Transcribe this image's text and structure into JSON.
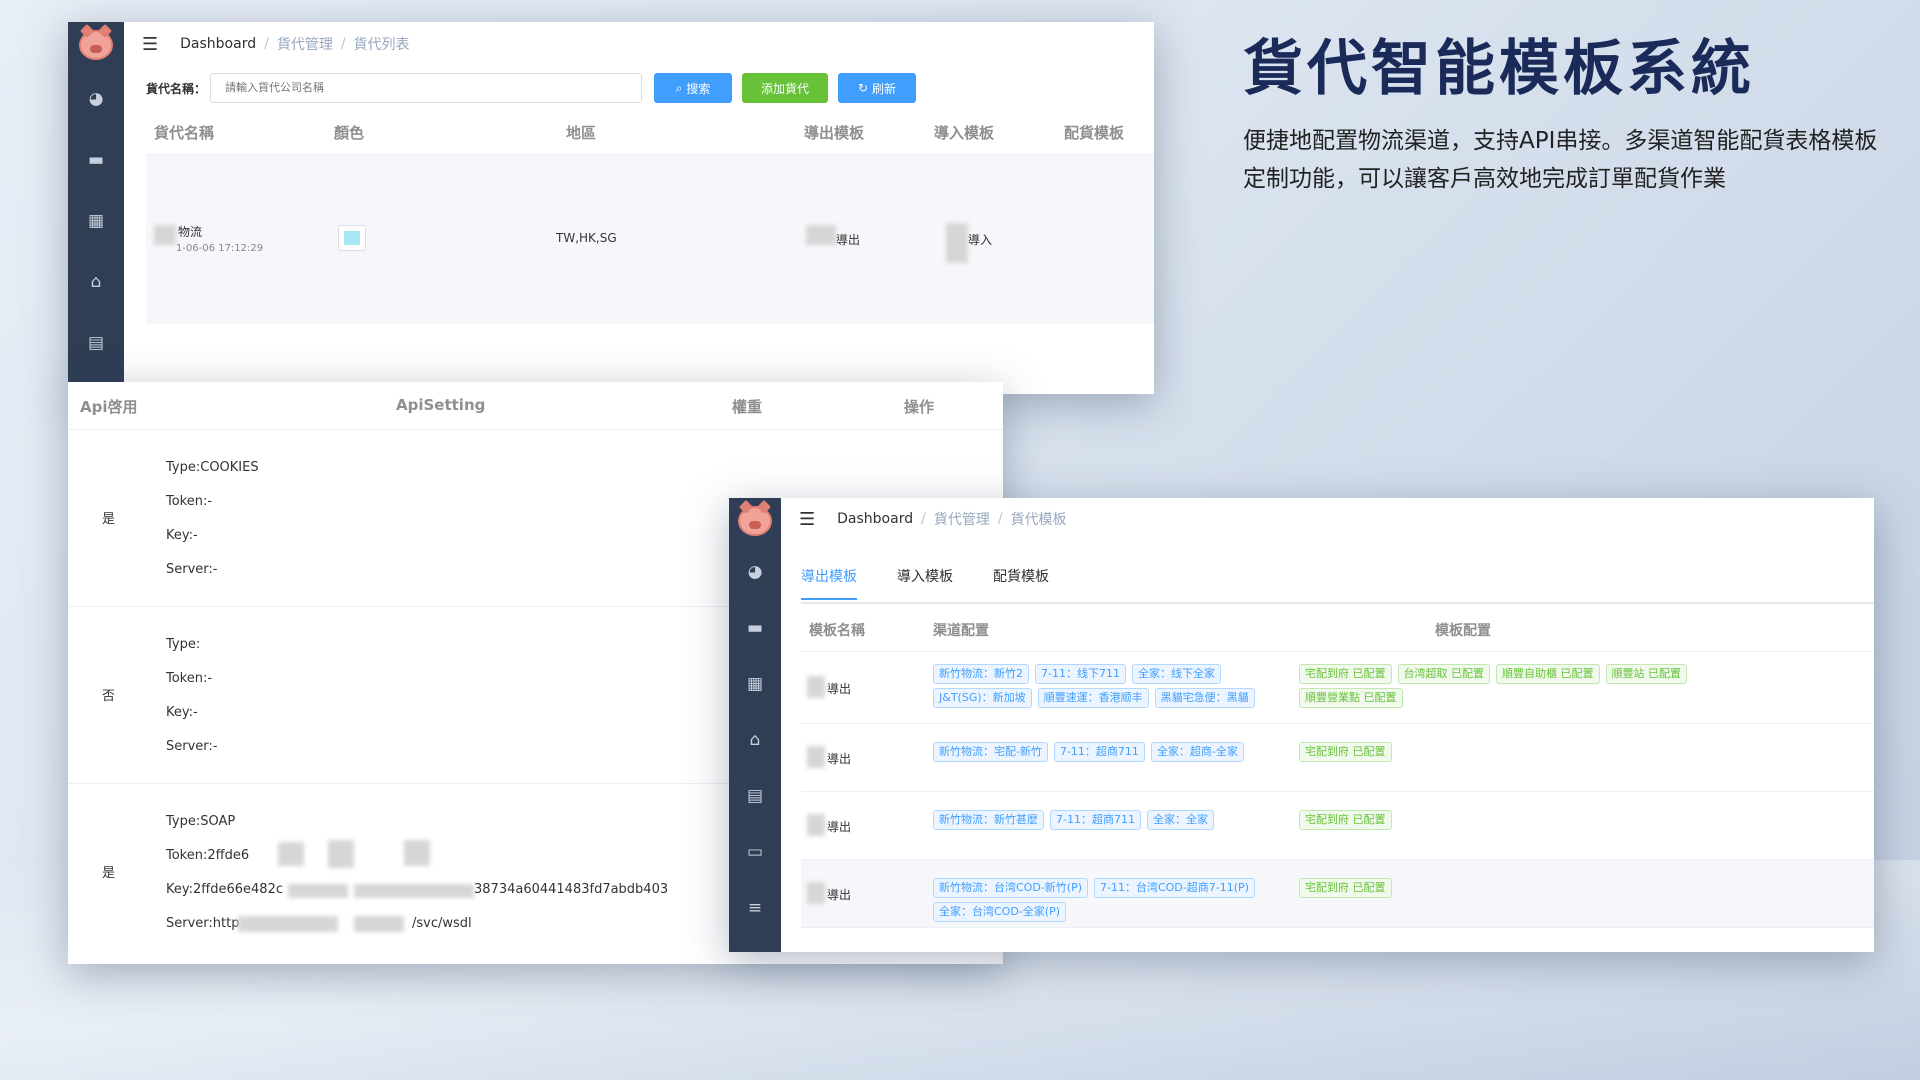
{
  "headline": {
    "title": "貨代智能模板系統",
    "description": "便捷地配置物流渠道，支持API串接。多渠道智能配貨表格模板定制功能，可以讓客戶高效地完成訂單配貨作業"
  },
  "window1": {
    "breadcrumb": [
      "Dashboard",
      "貨代管理",
      "貨代列表"
    ],
    "search_label": "貨代名稱：",
    "search_placeholder": "請輸入貨代公司名稱",
    "buttons": {
      "search": "搜索",
      "add": "添加貨代",
      "refresh": "刷新"
    },
    "columns": [
      "貨代名稱",
      "顏色",
      "地區",
      "導出模板",
      "導入模板",
      "配貨模板"
    ],
    "row": {
      "name": "物流",
      "date": "1-06-06 17:12:29",
      "region": "TW,HK,SG",
      "export": "導出",
      "import": "導入"
    }
  },
  "window2": {
    "columns": [
      "Api啓用",
      "ApiSetting",
      "權重",
      "操作"
    ],
    "rows": [
      {
        "enabled": "是",
        "type": "Type:COOKIES",
        "token": "Token:-",
        "key": "Key:-",
        "server": "Server:-"
      },
      {
        "enabled": "否",
        "type": "Type:",
        "token": "Token:-",
        "key": "Key:-",
        "server": "Server:-"
      },
      {
        "enabled": "是",
        "type": "Type:SOAP",
        "token": "Token:2ffde6",
        "key": "Key:2ffde66e482c",
        "key_tail": "38734a60441483fd7abdb403",
        "server": "Server:http",
        "server_tail": "/svc/wsdl"
      }
    ]
  },
  "window3": {
    "breadcrumb": [
      "Dashboard",
      "貨代管理",
      "貨代模板"
    ],
    "tabs": [
      "導出模板",
      "導入模板",
      "配貨模板"
    ],
    "columns": [
      "模板名稱",
      "渠道配置",
      "模板配置"
    ],
    "rows": [
      {
        "name": "導出",
        "channels": [
          "新竹物流：新竹2",
          "7-11：线下711",
          "全家：线下全家",
          "J&T(SG)：新加坡",
          "順豐速運：香港顺丰",
          "黑貓宅急便：黑貓"
        ],
        "configs": [
          "宅配到府 已配置",
          "台湾超取 已配置",
          "順豐自助櫃 已配置",
          "順豐站 已配置",
          "順豐營業點 已配置"
        ]
      },
      {
        "name": "導出",
        "channels": [
          "新竹物流：宅配-新竹",
          "7-11：超商711",
          "全家：超商-全家"
        ],
        "configs": [
          "宅配到府 已配置"
        ]
      },
      {
        "name": "導出",
        "channels": [
          "新竹物流：新竹甚麽",
          "7-11：超商711",
          "全家：全家"
        ],
        "configs": [
          "宅配到府 已配置"
        ]
      },
      {
        "name": "導出",
        "channels": [
          "新竹物流：台湾COD-新竹(P)",
          "7-11：台湾COD-超商7-11(P)",
          "全家：台湾COD-全家(P)"
        ],
        "configs": [
          "宅配到府 已配置"
        ]
      }
    ]
  },
  "colors": {
    "primary": "#409eff",
    "success": "#67c23a",
    "sidebar": "#2f3e55",
    "title": "#1a2b5a"
  },
  "icons": [
    "menu-fold-icon",
    "dashboard-icon",
    "storage-icon",
    "grid-icon",
    "shopping-bag-icon",
    "clipboard-icon",
    "chat-icon",
    "list-icon",
    "search-icon",
    "refresh-icon"
  ]
}
